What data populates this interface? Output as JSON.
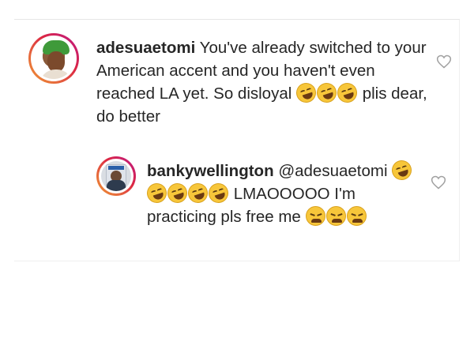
{
  "comments": [
    {
      "username": "adesuaetomi",
      "text_before_emoji": "You've already switched to your American accent and you haven't even reached LA yet. So disloyal",
      "emoji_name": "rolling-on-floor-laughing",
      "emoji_count": 3,
      "text_after_emoji": "plis dear, do better"
    },
    {
      "username": "bankywellington",
      "mention": "@adesuaetomi",
      "emoji_name": "rolling-on-floor-laughing",
      "emoji_count": 5,
      "text_after_emoji": "LMAOOOOO I'm practicing pls free me",
      "trailing_emoji_name": "tired-face",
      "trailing_emoji_count": 3
    }
  ],
  "icons": {
    "like": "heart-outline-icon"
  },
  "colors": {
    "text": "#262626",
    "heart": "#a0a0a0",
    "avatar_ring_start": "#f09433",
    "avatar_ring_end": "#bc1888"
  }
}
